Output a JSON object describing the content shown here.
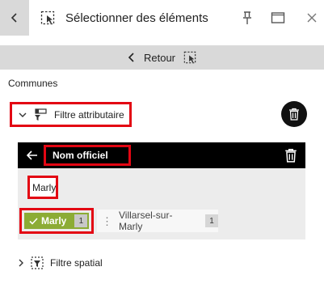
{
  "header": {
    "title": "Sélectionner des éléments",
    "icons": [
      "chevron-left-icon",
      "select-area-icon",
      "pin-icon",
      "maximize-icon",
      "close-icon"
    ]
  },
  "retour": {
    "label": "Retour"
  },
  "section": {
    "title": "Communes"
  },
  "filtre_attributaire": {
    "label": "Filtre attributaire"
  },
  "panel": {
    "field_name": "Nom officiel",
    "input_value": "Marly",
    "chips": [
      {
        "label": "Marly",
        "count": "1",
        "selected": true
      },
      {
        "label": "Villarsel-sur-Marly",
        "count": "1",
        "selected": false
      }
    ]
  },
  "filtre_spatial": {
    "label": "Filtre spatial"
  },
  "colors": {
    "accent_green": "#8cac35",
    "highlight_red": "#e30613",
    "header_gray": "#d9d9d9"
  }
}
